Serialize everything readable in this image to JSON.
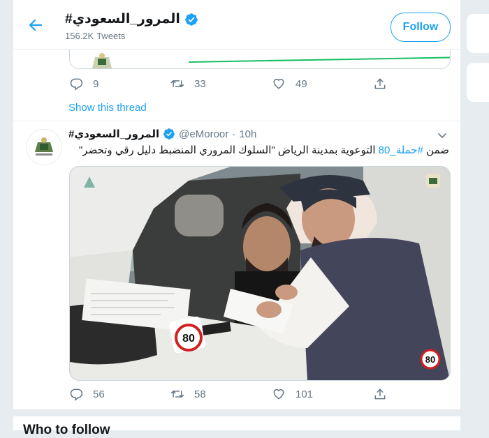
{
  "header": {
    "title": "#المرور_السعودي",
    "tweet_count": "156.2K",
    "tweet_label": "Tweets",
    "follow_label": "Follow"
  },
  "thread_tweet": {
    "actions": {
      "replies": "9",
      "retweets": "33",
      "likes": "49"
    },
    "show_thread": "Show this thread"
  },
  "tweet": {
    "name": "#المرور_السعودي",
    "handle": "@eMoroor",
    "dot": "·",
    "time": "10h",
    "text_prefix": "ضمن ",
    "hashtag": "#حملة_80",
    "text_body": " التوعوية بمدينة الرياض \"السلوك المروري المنضبط دليل رقي وتحضر\"",
    "media_badge": "80",
    "sign_text": "80",
    "actions": {
      "replies": "56",
      "retweets": "58",
      "likes": "101"
    }
  },
  "sidebar_heading": "Who to follow",
  "colors": {
    "accent": "#1da1f2",
    "text": "#14171a",
    "muted": "#657786",
    "bg": "#e6ecf0"
  }
}
